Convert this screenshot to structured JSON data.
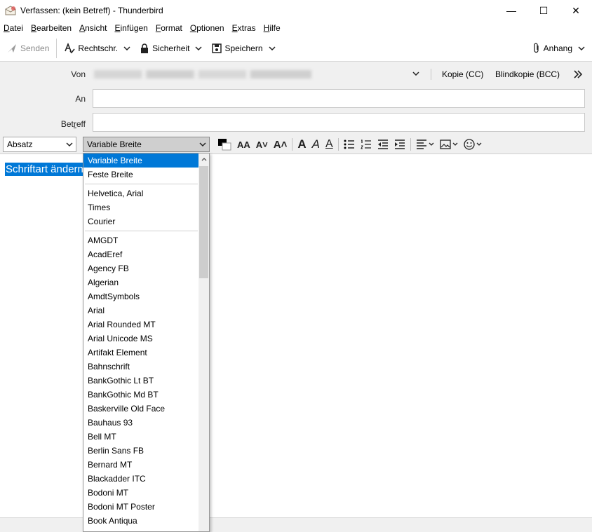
{
  "window": {
    "title": "Verfassen: (kein Betreff) - Thunderbird",
    "minimize": "—",
    "maximize": "☐",
    "close": "✕"
  },
  "menubar": {
    "items": [
      {
        "pre": "",
        "key": "D",
        "post": "atei"
      },
      {
        "pre": "",
        "key": "B",
        "post": "earbeiten"
      },
      {
        "pre": "",
        "key": "A",
        "post": "nsicht"
      },
      {
        "pre": "",
        "key": "E",
        "post": "infügen"
      },
      {
        "pre": "",
        "key": "F",
        "post": "ormat"
      },
      {
        "pre": "",
        "key": "O",
        "post": "ptionen"
      },
      {
        "pre": "",
        "key": "E",
        "post": "xtras"
      },
      {
        "pre": "",
        "key": "H",
        "post": "ilfe"
      }
    ]
  },
  "toolbar": {
    "send": "Senden",
    "spelling": "Rechtschr.",
    "security": "Sicherheit",
    "save": "Speichern",
    "attach": "Anhang"
  },
  "header": {
    "from_label": "Von",
    "to_label": "An",
    "subject_label_pre": "Bet",
    "subject_label_key": "r",
    "subject_label_post": "eff",
    "cc": "Kopie (CC)",
    "bcc": "Blindkopie (BCC)"
  },
  "format": {
    "paragraph": "Absatz",
    "font": "Variable Breite"
  },
  "editor": {
    "selected_text": "Schriftart ändern"
  },
  "font_dropdown": {
    "group1": [
      "Variable Breite",
      "Feste Breite"
    ],
    "group2": [
      "Helvetica, Arial",
      "Times",
      "Courier"
    ],
    "group3": [
      "AMGDT",
      "AcadEref",
      "Agency FB",
      "Algerian",
      "AmdtSymbols",
      "Arial",
      "Arial Rounded MT",
      "Arial Unicode MS",
      "Artifakt Element",
      "Bahnschrift",
      "BankGothic Lt BT",
      "BankGothic Md BT",
      "Baskerville Old Face",
      "Bauhaus 93",
      "Bell MT",
      "Berlin Sans FB",
      "Bernard MT",
      "Blackadder ITC",
      "Bodoni MT",
      "Bodoni MT Poster",
      "Book Antiqua"
    ],
    "highlighted_index": 0
  },
  "colors": {
    "accent": "#0078d7",
    "chrome": "#f0f0f0"
  }
}
